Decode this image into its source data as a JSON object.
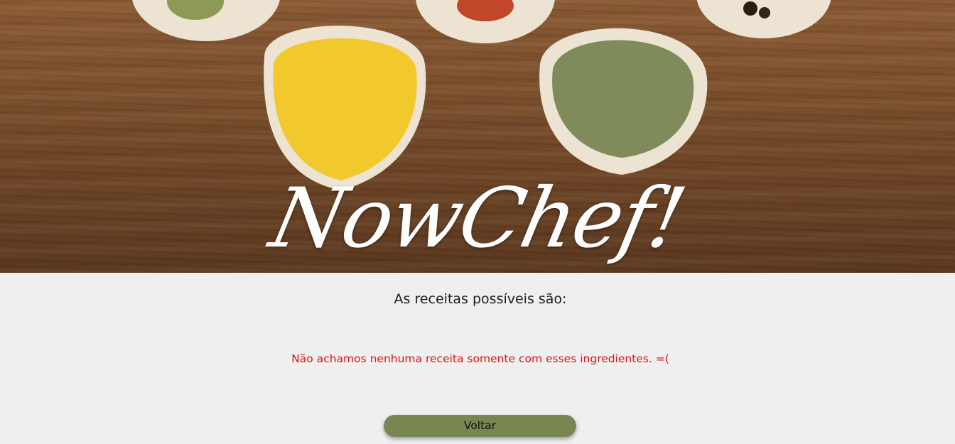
{
  "header": {
    "logo_text": "NowChef!"
  },
  "main": {
    "heading": "As receitas possíveis são:",
    "empty_message": "Não achamos nenhuma receita somente com esses ingredientes. =(",
    "back_button_label": "Voltar"
  },
  "colors": {
    "accent": "#788751",
    "error_text": "#e01414",
    "page_background": "#efefef"
  }
}
